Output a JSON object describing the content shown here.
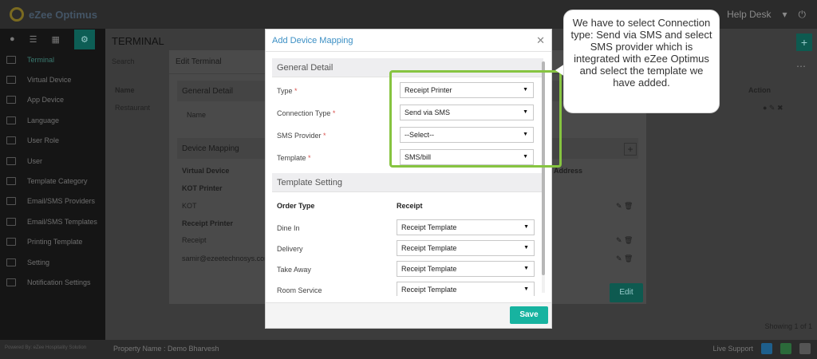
{
  "app": {
    "brand": "eZee Optimus",
    "help_desk": "Help Desk",
    "page_title": "TERMINAL",
    "search_label": "Search",
    "list_header": "Name",
    "list_row": "Restaurant",
    "action_header": "Action",
    "showing": "Showing 1 of 1",
    "footer_left": "Powered By: eZee Hospitality Solution",
    "footer_property": "Property Name : Demo Bharvesh",
    "footer_support": "Live Support"
  },
  "sidebar": {
    "items": [
      {
        "label": "Terminal",
        "active": true
      },
      {
        "label": "Virtual Device"
      },
      {
        "label": "App Device"
      },
      {
        "label": "Language"
      },
      {
        "label": "User Role"
      },
      {
        "label": "User"
      },
      {
        "label": "Template Category"
      },
      {
        "label": "Email/SMS Providers"
      },
      {
        "label": "Email/SMS Templates"
      },
      {
        "label": "Printing Template"
      },
      {
        "label": "Setting"
      },
      {
        "label": "Notification Settings"
      }
    ]
  },
  "edit_panel": {
    "title": "Edit Terminal",
    "general_detail": "General Detail",
    "name_label": "Name",
    "device_mapping": "Device Mapping",
    "virtual_device_header": "Virtual Device",
    "address_header": "Address",
    "rows": [
      {
        "label": "KOT Printer",
        "bold": true
      },
      {
        "label": "KOT",
        "bold": false
      },
      {
        "label": "Receipt Printer",
        "bold": true
      },
      {
        "label": "Receipt",
        "bold": false
      },
      {
        "label": "samir@ezeetechnosys.com",
        "bold": false
      }
    ],
    "edit_button": "Edit"
  },
  "modal": {
    "title": "Add Device Mapping",
    "general_detail": "General Detail",
    "fields": {
      "type": {
        "label": "Type",
        "value": "Receipt Printer"
      },
      "connection_type": {
        "label": "Connection Type",
        "value": "Send via SMS"
      },
      "sms_provider": {
        "label": "SMS Provider",
        "value": "--Select--"
      },
      "template": {
        "label": "Template",
        "value": "SMS/bill"
      }
    },
    "required_mark": "*",
    "template_setting": "Template Setting",
    "order_type_header": "Order Type",
    "receipt_header": "Receipt",
    "order_rows": [
      {
        "order_type": "Dine In",
        "receipt": "Receipt Template"
      },
      {
        "order_type": "Delivery",
        "receipt": "Receipt Template"
      },
      {
        "order_type": "Take Away",
        "receipt": "Receipt Template"
      },
      {
        "order_type": "Room Service",
        "receipt": "Receipt Template"
      }
    ],
    "save_button": "Save"
  },
  "callout": {
    "text": "We have to select Connection type: Send via SMS and select SMS provider which is integrated with eZee Optimus and select the template we have added."
  },
  "colors": {
    "accent": "#17b3a0",
    "modal_title": "#3b8fc4",
    "highlight": "#86c440",
    "required": "#d9534f"
  }
}
